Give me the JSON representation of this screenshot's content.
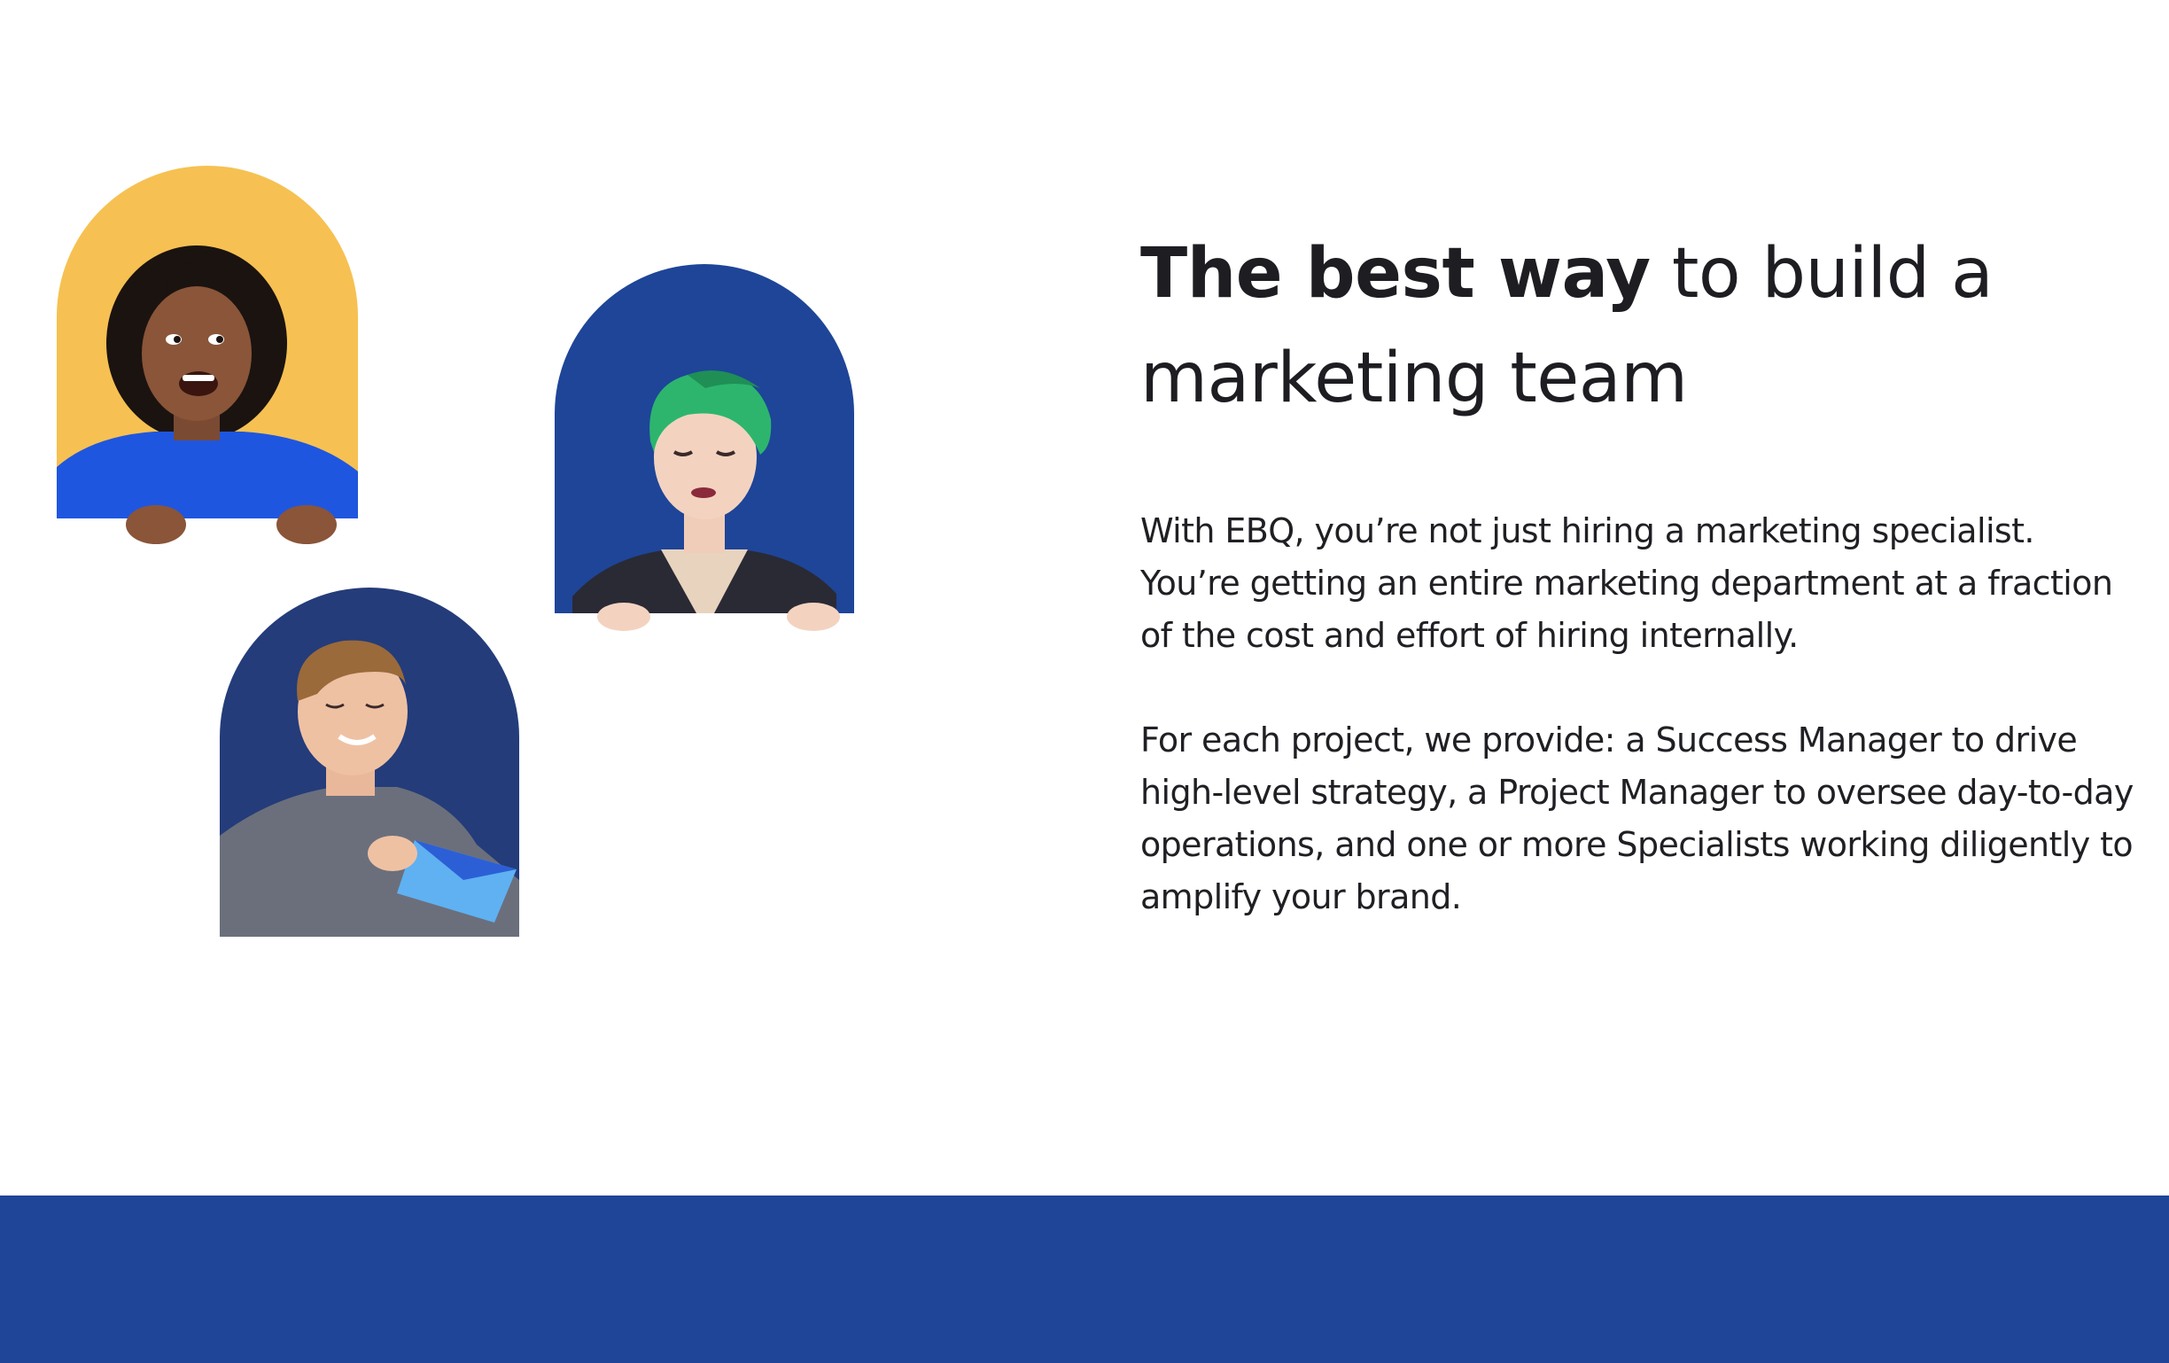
{
  "hero": {
    "headline_bold": "The best way",
    "headline_rest": " to build a marketing team",
    "paragraph_1": "With EBQ, you’re not just hiring a marketing specialist. You’re getting an entire marketing department at a fraction of the cost and effort of hiring internally.",
    "paragraph_2": "For each project, we provide: a Success Manager to drive high-level strategy, a Project Manager to oversee day-to-day operations, and one or more Specialists working diligently to amplify your brand."
  },
  "colors": {
    "arch_yellow": "#F6C152",
    "arch_blue": "#1E4598",
    "arch_navy": "#243C7A",
    "footer_band": "#1E4598",
    "text": "#1f1f24"
  },
  "portraits": [
    {
      "icon": "woman-smiling-portrait-icon",
      "background": "yellow"
    },
    {
      "icon": "green-hair-person-portrait-icon",
      "background": "blue"
    },
    {
      "icon": "man-with-envelope-portrait-icon",
      "background": "navy"
    }
  ]
}
